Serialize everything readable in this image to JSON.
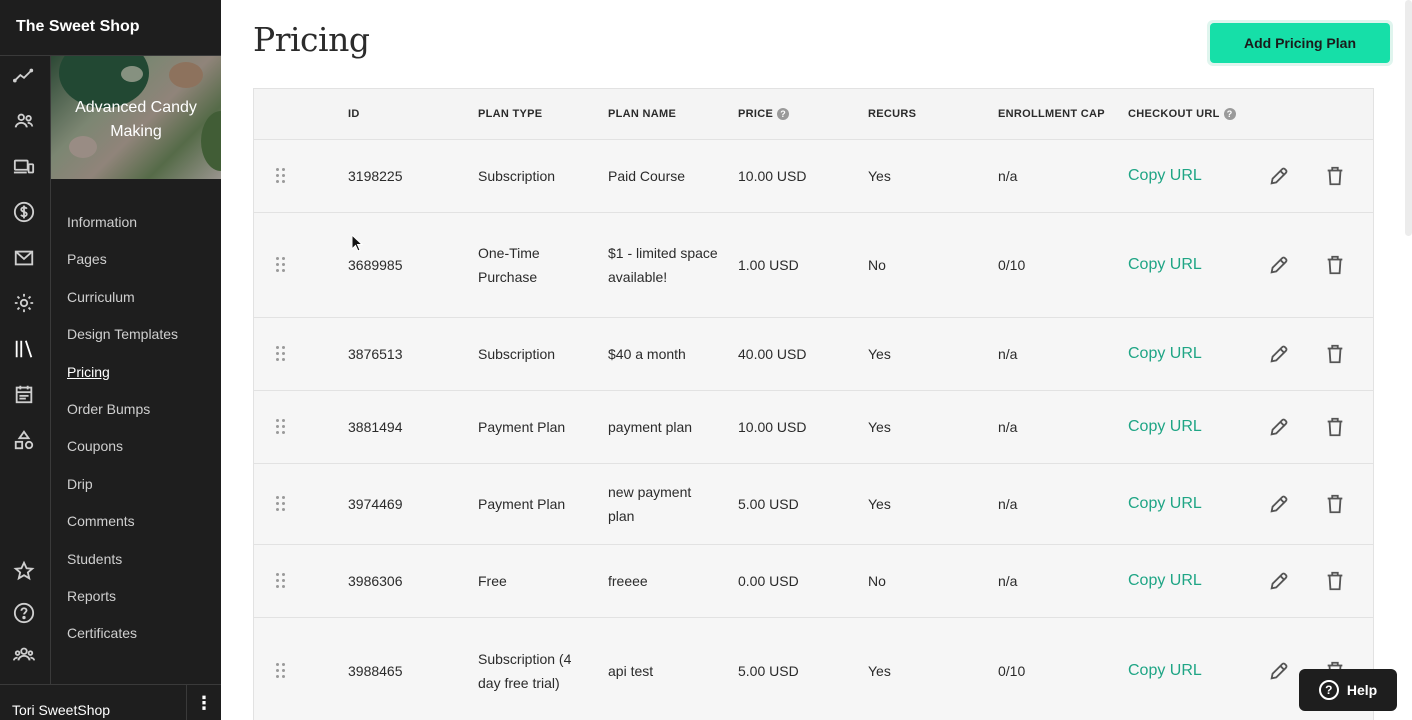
{
  "sidebar": {
    "school_name": "The Sweet Shop",
    "course_title": "Advanced Candy Making",
    "rail_icons": [
      "analytics-icon",
      "users-icon",
      "devices-icon",
      "dollar-icon",
      "mail-icon",
      "settings-icon",
      "library-icon",
      "calendar-icon",
      "shapes-icon",
      "star-icon",
      "help-circle-icon",
      "community-icon"
    ],
    "nav_items": [
      {
        "label": "Information"
      },
      {
        "label": "Pages"
      },
      {
        "label": "Curriculum"
      },
      {
        "label": "Design Templates"
      },
      {
        "label": "Pricing"
      },
      {
        "label": "Order Bumps"
      },
      {
        "label": "Coupons"
      },
      {
        "label": "Drip"
      },
      {
        "label": "Comments"
      },
      {
        "label": "Students"
      },
      {
        "label": "Reports"
      },
      {
        "label": "Certificates"
      }
    ],
    "active_item": "Pricing",
    "user_name": "Tori SweetShop",
    "user_menu_glyph": "⋮"
  },
  "main": {
    "title": "Pricing",
    "add_button_label": "Add Pricing Plan",
    "columns": {
      "id": "ID",
      "plan_type": "PLAN TYPE",
      "plan_name": "PLAN NAME",
      "price": "PRICE",
      "recurs": "RECURS",
      "enrollment_cap": "ENROLLMENT CAP",
      "checkout_url": "CHECKOUT URL"
    },
    "copy_label": "Copy URL",
    "rows": [
      {
        "id": "3198225",
        "plan_type": "Subscription",
        "plan_name": "Paid Course",
        "price": "10.00 USD",
        "recurs": "Yes",
        "cap": "n/a"
      },
      {
        "id": "3689985",
        "plan_type": "One-Time Purchase",
        "plan_name": "$1 - limited space available!",
        "price": "1.00 USD",
        "recurs": "No",
        "cap": "0/10"
      },
      {
        "id": "3876513",
        "plan_type": "Subscription",
        "plan_name": "$40 a month",
        "price": "40.00 USD",
        "recurs": "Yes",
        "cap": "n/a"
      },
      {
        "id": "3881494",
        "plan_type": "Payment Plan",
        "plan_name": "payment plan",
        "price": "10.00 USD",
        "recurs": "Yes",
        "cap": "n/a"
      },
      {
        "id": "3974469",
        "plan_type": "Payment Plan",
        "plan_name": "new payment plan",
        "price": "5.00 USD",
        "recurs": "Yes",
        "cap": "n/a"
      },
      {
        "id": "3986306",
        "plan_type": "Free",
        "plan_name": "freeee",
        "price": "0.00 USD",
        "recurs": "No",
        "cap": "n/a"
      },
      {
        "id": "3988465",
        "plan_type": "Subscription (4 day free trial)",
        "plan_name": "api test",
        "price": "5.00 USD",
        "recurs": "Yes",
        "cap": "0/10"
      }
    ]
  },
  "help_button": {
    "label": "Help"
  },
  "colors": {
    "accent": "#16dfa8",
    "link": "#1fa585",
    "sidebar_bg": "#1e1e1e"
  }
}
